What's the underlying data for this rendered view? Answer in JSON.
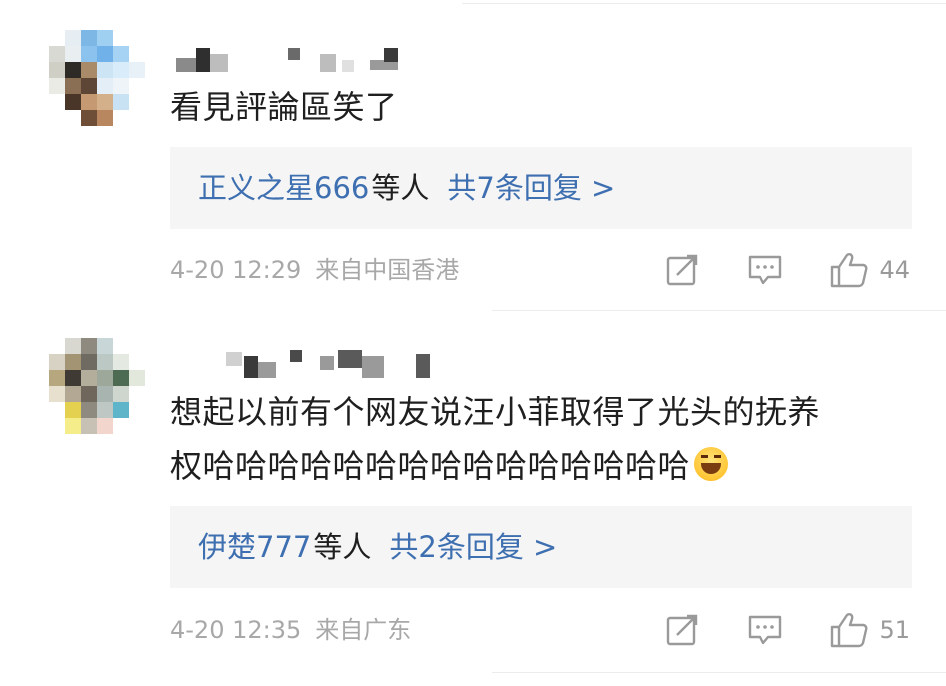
{
  "comments": [
    {
      "text": "看見評論區笑了",
      "reply": {
        "names": "正义之星666",
        "suffix": "等人",
        "count_text": "共7条回复 >"
      },
      "date": "4-20 12:29",
      "source": "来自中国香港",
      "likes": "44",
      "icons": [
        "share-icon",
        "comment-icon",
        "like-icon"
      ]
    },
    {
      "text_line1": "想起以前有个网友说汪小菲取得了光头的抚养",
      "text_line2": "权哈哈哈哈哈哈哈哈哈哈哈哈哈哈哈",
      "emoji": "laughing-tears-emoji",
      "reply": {
        "names": "伊楚777",
        "suffix": "等人",
        "count_text": "共2条回复 >"
      },
      "date": "4-20 12:35",
      "source": "来自广东",
      "likes": "51",
      "icons": [
        "share-icon",
        "comment-icon",
        "like-icon"
      ]
    }
  ],
  "colors": {
    "link": "#3e6fb0",
    "meta": "#a8a8a8",
    "reply_bg": "#f5f5f5",
    "text": "#1f1f1f"
  }
}
